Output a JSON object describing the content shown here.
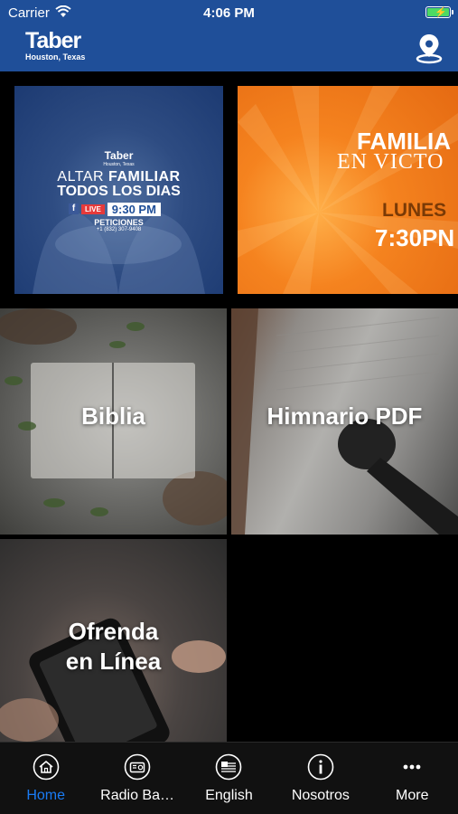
{
  "status_bar": {
    "carrier": "Carrier",
    "time": "4:06 PM"
  },
  "header": {
    "logo_text": "Taber",
    "logo_subtext": "Houston, Texas",
    "location_icon": "map-pin-icon"
  },
  "tiles": {
    "altar": {
      "logo": "Taber",
      "logo_sub": "Houston, Texas",
      "line1_a": "ALTAR ",
      "line1_b": "FAMILIAR",
      "line2": "TODOS LOS DIAS",
      "live": "LIVE",
      "time": "9:30 PM",
      "peticiones": "PETICIONES",
      "phone": "+1 (832) 307-9408"
    },
    "familia": {
      "title": "FAMILIA",
      "subtitle": "EN VICTO",
      "day": "LUNES",
      "time": "7:30PN"
    },
    "biblia": {
      "label": "Biblia"
    },
    "himnario": {
      "label": "Himnario PDF"
    },
    "ofrenda": {
      "label_line1": "Ofrenda",
      "label_line2": "en Línea"
    }
  },
  "tabbar": {
    "tabs": [
      {
        "label": "Home",
        "icon": "home-icon",
        "active": true
      },
      {
        "label": "Radio Ba…",
        "icon": "radio-icon",
        "active": false
      },
      {
        "label": "English",
        "icon": "us-flag-icon",
        "active": false
      },
      {
        "label": "Nosotros",
        "icon": "info-icon",
        "active": false
      },
      {
        "label": "More",
        "icon": "more-icon",
        "active": false
      }
    ],
    "active_color": "#1a7cf5"
  },
  "colors": {
    "header_bg": "#1f4f99",
    "background": "#000000",
    "tabbar_bg": "#111111"
  }
}
